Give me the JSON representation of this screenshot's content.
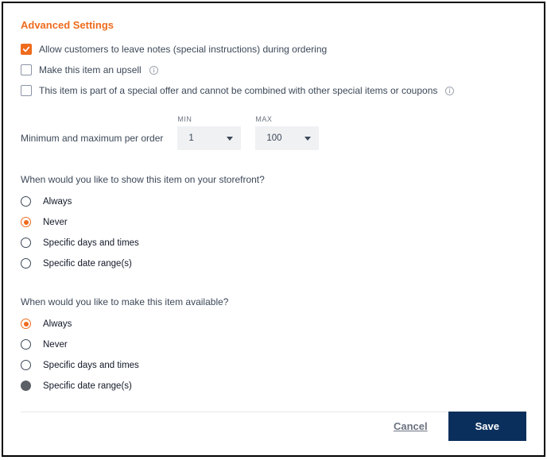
{
  "title": "Advanced Settings",
  "checkboxes": {
    "notes": {
      "label": "Allow customers to leave notes (special instructions) during ordering",
      "checked": true
    },
    "upsell": {
      "label": "Make this item an upsell",
      "checked": false
    },
    "special": {
      "label": "This item is part of a special offer and cannot be combined with other special items or coupons",
      "checked": false
    }
  },
  "minmax": {
    "label": "Minimum and maximum per order",
    "min_caption": "MIN",
    "max_caption": "MAX",
    "min_value": "1",
    "max_value": "100"
  },
  "show_section": {
    "question": "When would you like to show this item on your storefront?",
    "options": [
      "Always",
      "Never",
      "Specific days and times",
      "Specific date range(s)"
    ],
    "selected_index": 1
  },
  "avail_section": {
    "question": "When would you like to make this item available?",
    "options": [
      "Always",
      "Never",
      "Specific days and times",
      "Specific date range(s)"
    ],
    "selected_index": 0
  },
  "footer": {
    "cancel": "Cancel",
    "save": "Save"
  }
}
